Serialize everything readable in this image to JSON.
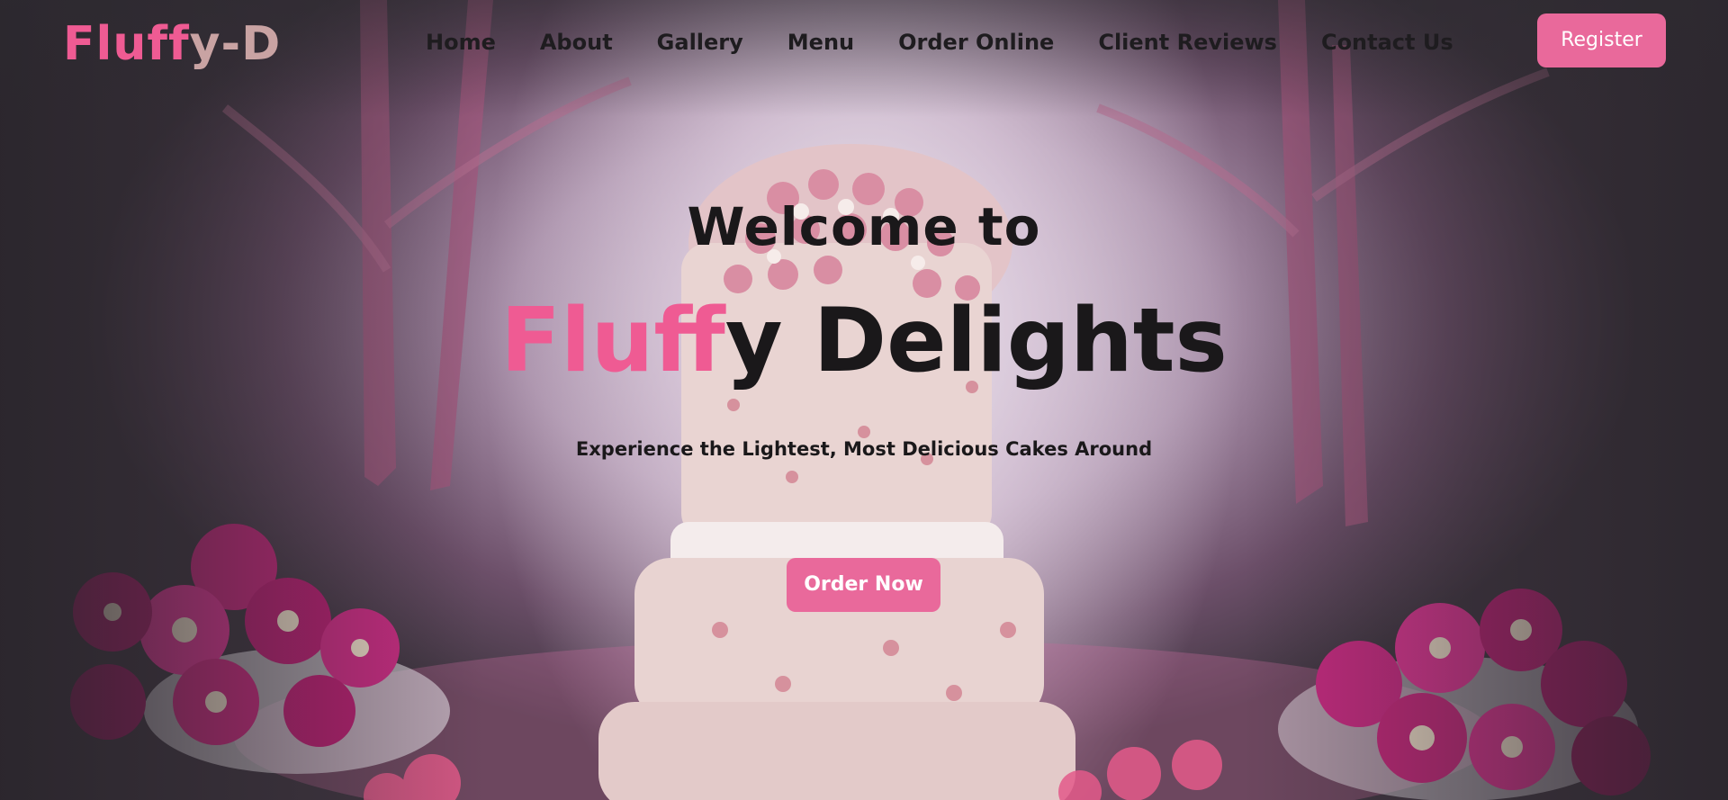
{
  "header": {
    "logo_part1": "Fluff",
    "logo_part2": "y-D",
    "nav": [
      "Home",
      "About",
      "Gallery",
      "Menu",
      "Order Online",
      "Client Reviews",
      "Contact Us"
    ],
    "register_label": "Register"
  },
  "hero": {
    "welcome": "Welcome to",
    "brand_part1": "Fluff",
    "brand_part2": "y Delights",
    "tagline": "Experience the Lightest, Most Delicious Cakes Around",
    "order_label": "Order Now",
    "background_image": "pink-tiered-cake-in-floral-garden"
  },
  "colors": {
    "accent": "#e9699b",
    "brand_pink": "#ef5b93",
    "logo_muted": "#c9a3a3",
    "text_dark": "#1a181a"
  }
}
